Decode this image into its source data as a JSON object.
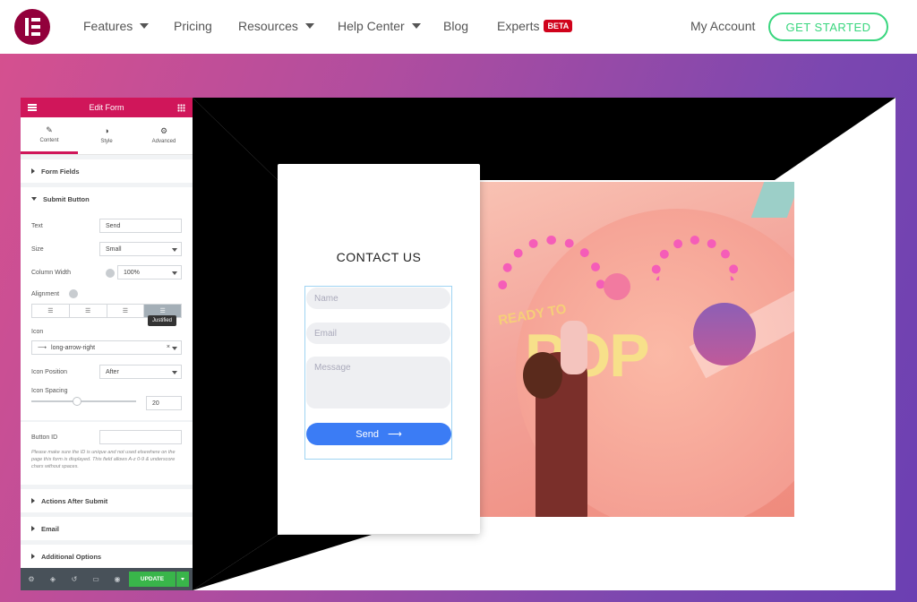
{
  "nav": {
    "features": "Features",
    "pricing": "Pricing",
    "resources": "Resources",
    "help_center": "Help Center",
    "blog": "Blog",
    "experts": "Experts",
    "beta_badge": "BETA",
    "my_account": "My Account",
    "get_started": "GET STARTED"
  },
  "panel": {
    "title": "Edit Form",
    "tabs": {
      "content": "Content",
      "style": "Style",
      "advanced": "Advanced"
    },
    "sections": {
      "form_fields": "Form Fields",
      "submit_button": "Submit Button",
      "actions_after_submit": "Actions After Submit",
      "email": "Email",
      "additional_options": "Additional Options"
    },
    "controls": {
      "text_label": "Text",
      "text_value": "Send",
      "size_label": "Size",
      "size_value": "Small",
      "column_width_label": "Column Width",
      "column_width_value": "100%",
      "alignment_label": "Alignment",
      "alignment_tooltip": "Justified",
      "icon_label": "Icon",
      "icon_value": "long-arrow-right",
      "icon_position_label": "Icon Position",
      "icon_position_value": "After",
      "icon_spacing_label": "Icon Spacing",
      "icon_spacing_value": "20",
      "button_id_label": "Button ID",
      "button_id_note": "Please make sure the ID is unique and not used elsewhere on the page this form is displayed. This field allows A-z 0-9 & underscore chars without spaces."
    },
    "update_label": "UPDATE"
  },
  "preview": {
    "form_title": "CONTACT US",
    "name_placeholder": "Name",
    "email_placeholder": "Email",
    "message_placeholder": "Message",
    "send_label": "Send",
    "photo_text_ready": "READY TO",
    "photo_text_pop": "POP"
  },
  "colors": {
    "brand": "#92003b",
    "panel_header": "#d0165a",
    "get_started": "#39d67e",
    "send_button": "#3b7cf5",
    "update_button": "#39b54a"
  }
}
